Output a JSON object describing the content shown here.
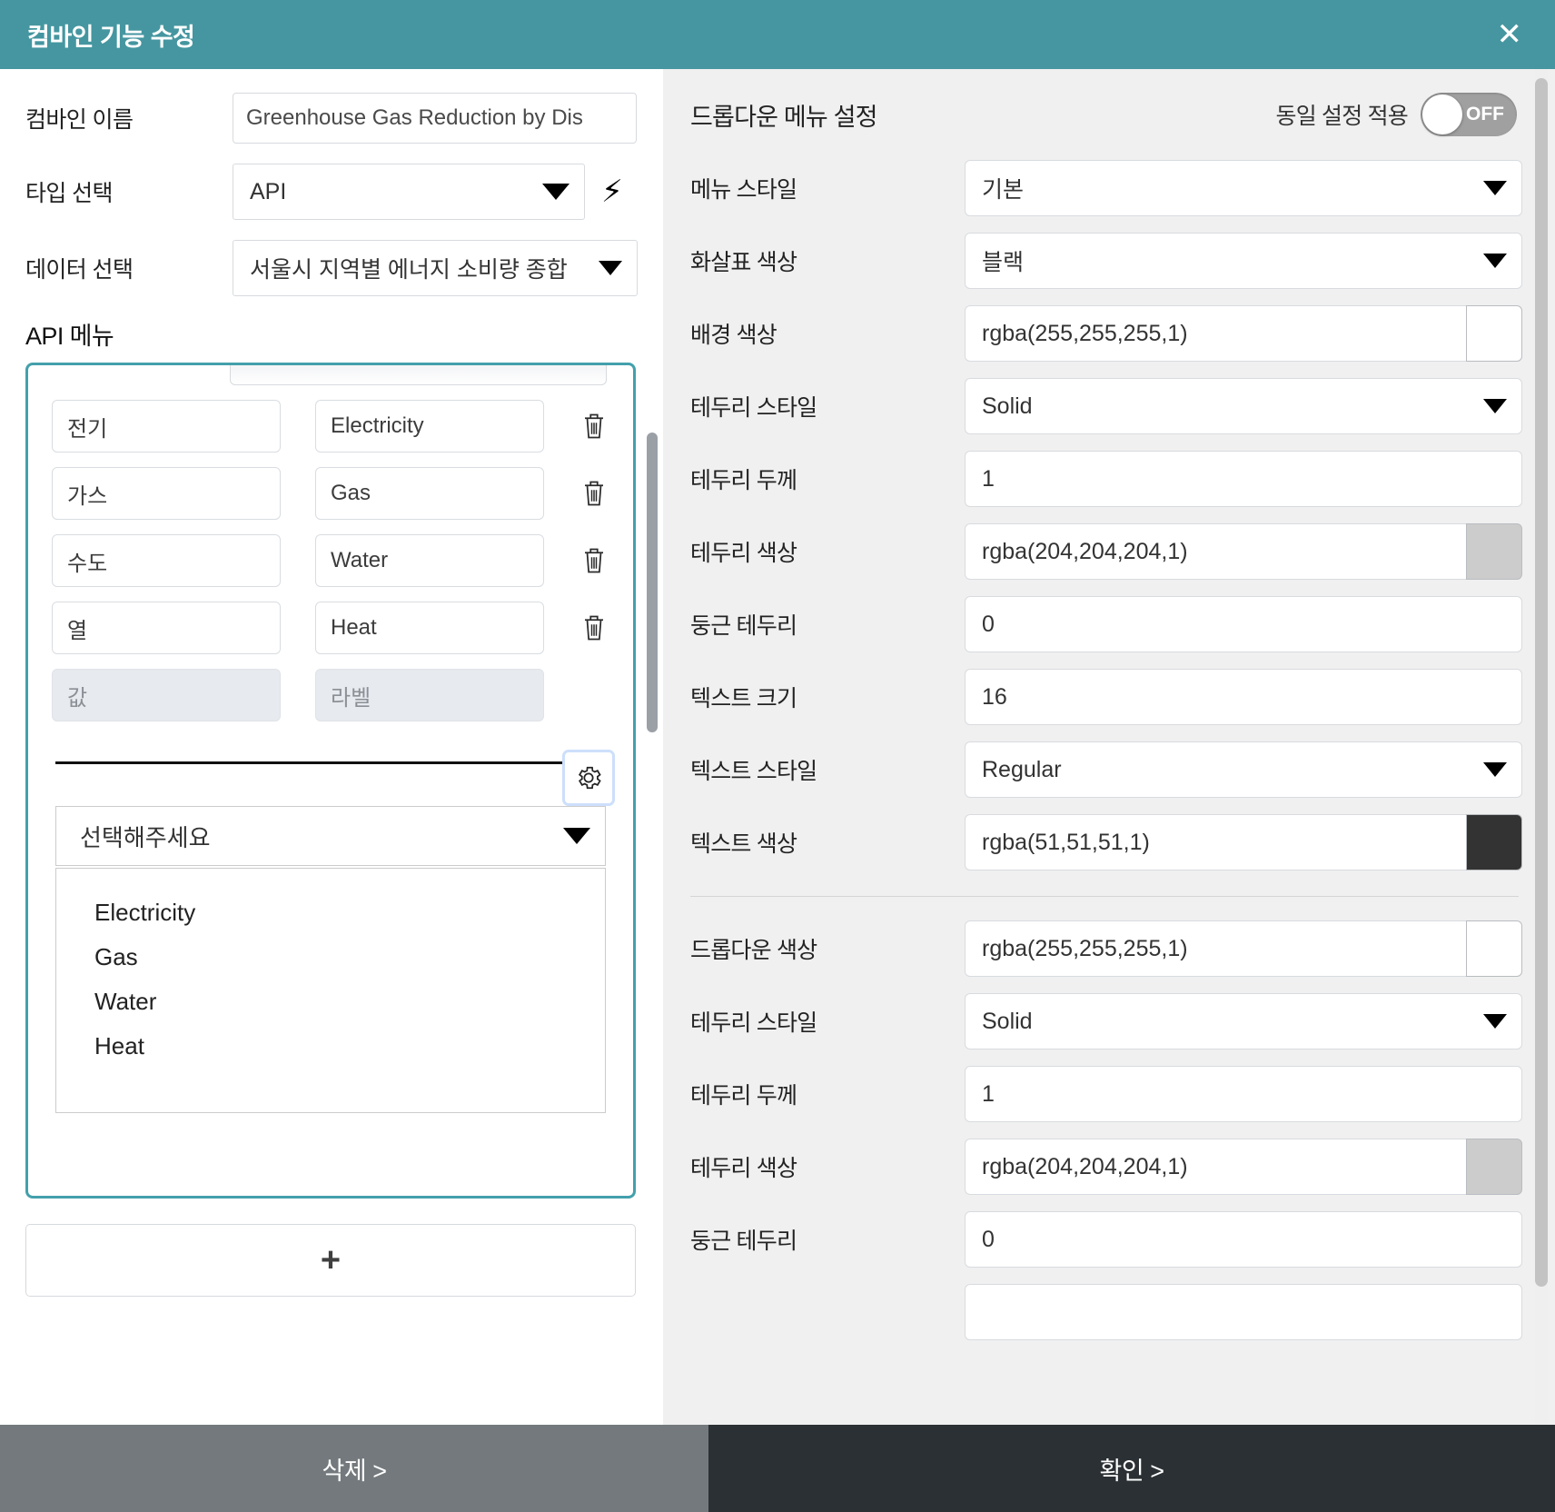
{
  "header": {
    "title": "컴바인 기능 수정",
    "close_icon": "close-icon"
  },
  "left": {
    "name_label": "컴바인 이름",
    "name_value": "Greenhouse Gas Reduction by Dis",
    "type_label": "타입 선택",
    "type_value": "API",
    "bolt_icon": "lightning-bolt-icon",
    "data_label": "데이터 선택",
    "data_value": "서울시 지역별 에너지 소비량 종합",
    "api_menu_title": "API 메뉴",
    "rows": [
      {
        "value": "전기",
        "label": "Electricity"
      },
      {
        "value": "가스",
        "label": "Gas"
      },
      {
        "value": "수도",
        "label": "Water"
      },
      {
        "value": "열",
        "label": "Heat"
      }
    ],
    "new_row": {
      "value_placeholder": "값",
      "label_placeholder": "라벨"
    },
    "gear_icon": "gear-icon",
    "preview_placeholder": "선택해주세요",
    "preview_options": [
      "Electricity",
      "Gas",
      "Water",
      "Heat"
    ],
    "add_label": "+"
  },
  "right": {
    "section_title": "드롭다운 메뉴 설정",
    "toggle_label": "동일 설정 적용",
    "toggle_state": "OFF",
    "group1": [
      {
        "label": "메뉴 스타일",
        "value": "기본",
        "kind": "select"
      },
      {
        "label": "화살표 색상",
        "value": "블랙",
        "kind": "select"
      },
      {
        "label": "배경 색상",
        "value": "rgba(255,255,255,1)",
        "kind": "color",
        "swatch": "#ffffff"
      },
      {
        "label": "테두리 스타일",
        "value": "Solid",
        "kind": "select"
      },
      {
        "label": "테두리 두께",
        "value": "1",
        "kind": "text"
      },
      {
        "label": "테두리 색상",
        "value": "rgba(204,204,204,1)",
        "kind": "color",
        "swatch": "#cccccc"
      },
      {
        "label": "둥근 테두리",
        "value": "0",
        "kind": "text"
      },
      {
        "label": "텍스트 크기",
        "value": "16",
        "kind": "text"
      },
      {
        "label": "텍스트 스타일",
        "value": "Regular",
        "kind": "select"
      },
      {
        "label": "텍스트 색상",
        "value": "rgba(51,51,51,1)",
        "kind": "color",
        "swatch": "#333333"
      }
    ],
    "group2": [
      {
        "label": "드롭다운 색상",
        "value": "rgba(255,255,255,1)",
        "kind": "color",
        "swatch": "#ffffff"
      },
      {
        "label": "테두리 스타일",
        "value": "Solid",
        "kind": "select"
      },
      {
        "label": "테두리 두께",
        "value": "1",
        "kind": "text"
      },
      {
        "label": "테두리 색상",
        "value": "rgba(204,204,204,1)",
        "kind": "color",
        "swatch": "#cccccc"
      },
      {
        "label": "둥근 테두리",
        "value": "0",
        "kind": "text"
      }
    ]
  },
  "footer": {
    "delete_label": "삭제 >",
    "confirm_label": "확인 >"
  },
  "colors": {
    "accent": "#4596a0",
    "card_border": "#43a0ab",
    "footer_delete": "#73797c",
    "footer_confirm": "#2b3034",
    "panel_bg": "#f0f0f0"
  }
}
